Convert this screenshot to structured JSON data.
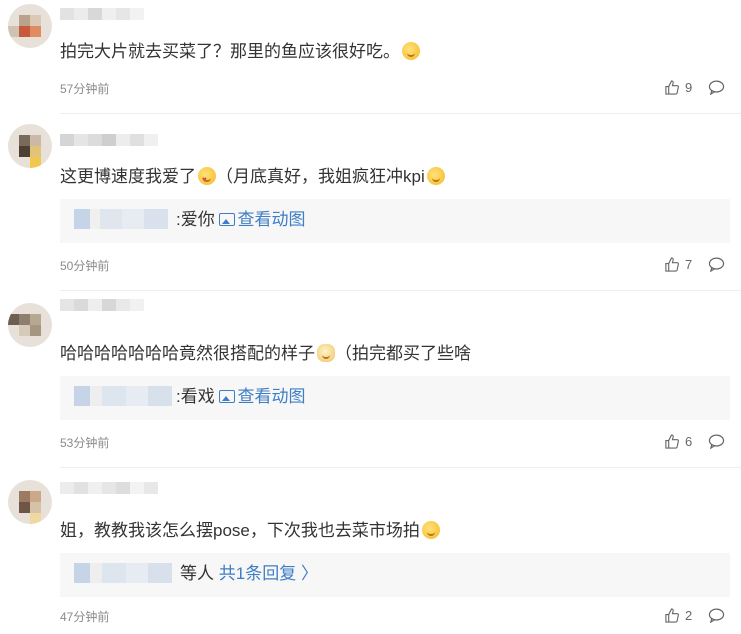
{
  "comments": [
    {
      "text": "拍完大片就去买菜了？那里的鱼应该很好吃。",
      "emoji": "laugh-emoji",
      "time": "57分钟前",
      "likes": "9"
    },
    {
      "text": "这更博速度我爱了",
      "text2": "（月底真好，我姐疯狂冲kpi",
      "emoji": "heart-eyes-emoji",
      "emoji2": "shy-emoji",
      "reply_text": ":爱你",
      "reply_link": "查看动图",
      "time": "50分钟前",
      "likes": "7"
    },
    {
      "text": "哈哈哈哈哈哈哈竟然很搭配的样子",
      "text2": "（拍完都买了些啥",
      "emoji": "doge-emoji",
      "reply_text": ":看戏",
      "reply_link": "查看动图",
      "time": "53分钟前",
      "likes": "6"
    },
    {
      "text": "姐，教教我该怎么摆pose，下次我也去菜市场拍",
      "emoji": "shy-emoji",
      "reply_text": "等人",
      "reply_link": "共1条回复",
      "time": "47分钟前",
      "likes": "2"
    }
  ],
  "colors": {
    "link": "#3e7ec4",
    "reply_bg": "#f7f7f7",
    "time": "#8a8a8a"
  }
}
